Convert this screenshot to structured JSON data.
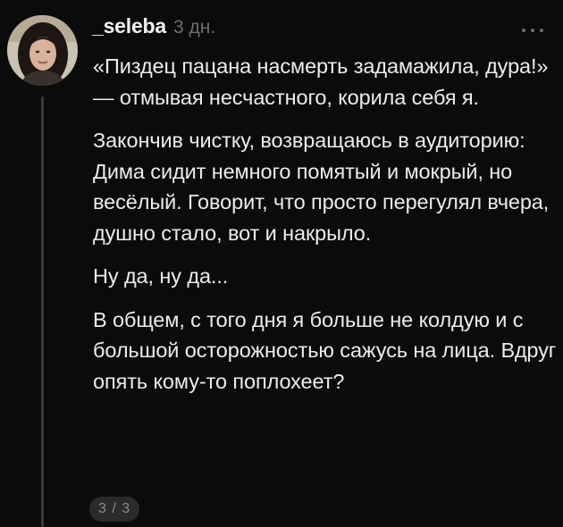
{
  "post": {
    "author": "_seleba",
    "time_ago": "3 дн.",
    "paragraphs": [
      "«Пиздец пацана насмерть задамажила, дура!» — отмывая несчастного, корила себя я.",
      "Закончив чистку, возвращаюсь в аудиторию: Дима сидит немного помятый и мокрый, но весёлый. Говорит, что просто перегулял вчера, душно стало, вот и накрыло.",
      "Ну да, ну да...",
      "В общем, с того дня я больше не колдую и с большой осторожностью сажусь на лица. Вдруг опять кому-то поплохеет?"
    ],
    "page_indicator": "3 / 3"
  },
  "icons": {
    "avatar": "user-avatar",
    "more": "more-horizontal-icon"
  },
  "colors": {
    "background": "#0b0b0b",
    "text": "#ececec",
    "muted": "#6e6e6e",
    "thread_line": "#3a3a3a",
    "badge_bg": "#2b2b2b"
  }
}
